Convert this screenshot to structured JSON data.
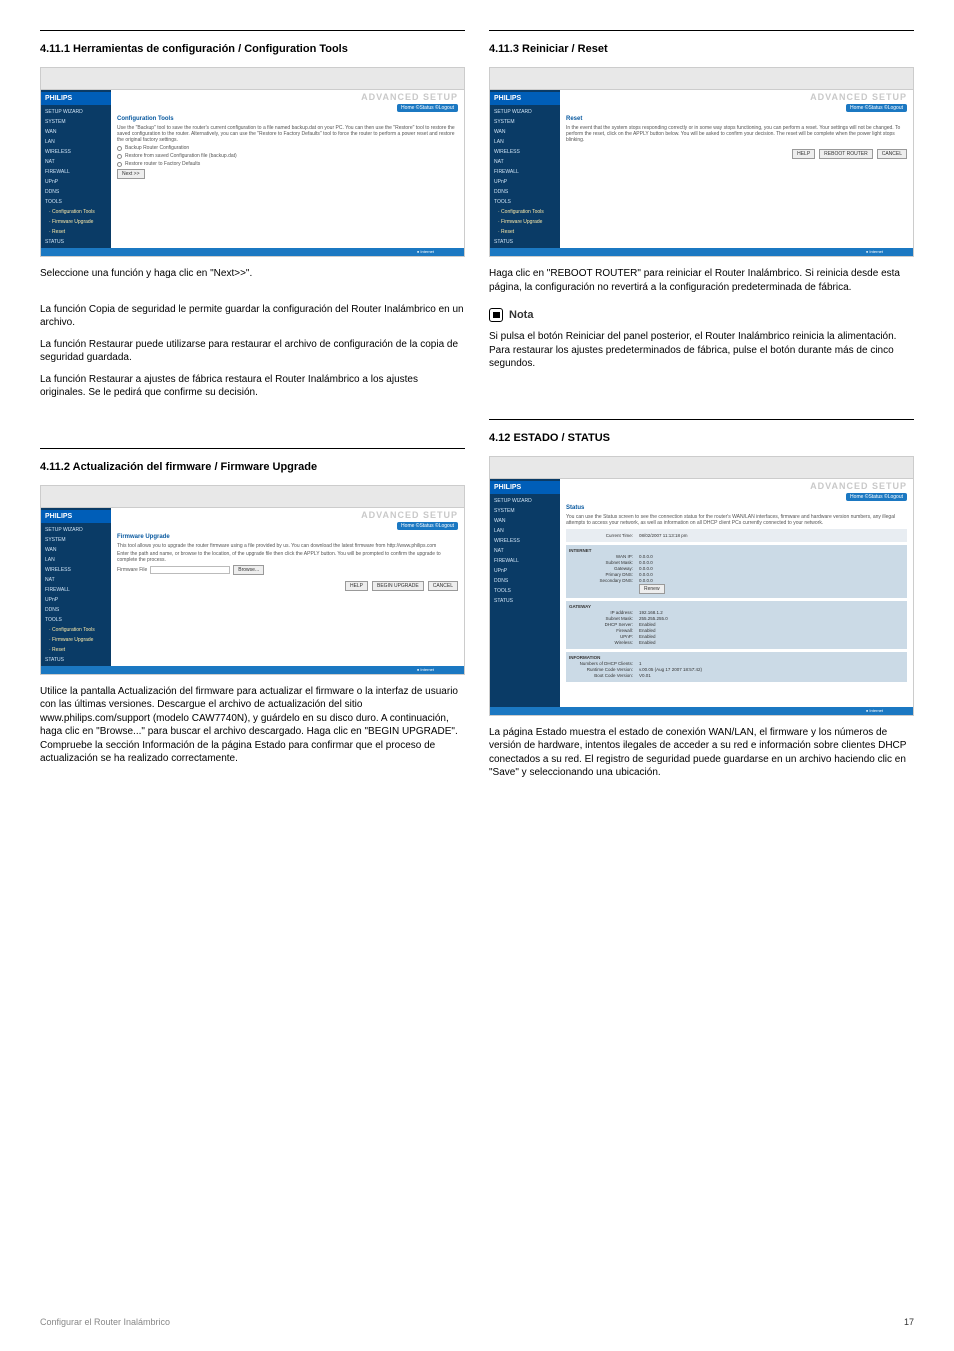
{
  "sections": {
    "s4111": {
      "title": "4.11.1 Herramientas de configuración / Configuration Tools",
      "caption": "Seleccione una función y haga clic en \"Next>>\".",
      "para1": "La función Copia de seguridad le permite guardar la configuración del Router Inalámbrico en un archivo.",
      "para2": "La función Restaurar puede utilizarse para restaurar el archivo de configuración de la copia de seguridad guardada.",
      "para3": "La función Restaurar a ajustes de fábrica restaura el Router Inalámbrico a los ajustes originales. Se le pedirá que confirme su decisión."
    },
    "s4112": {
      "title": "4.11.2 Actualización del firmware / Firmware Upgrade",
      "para1": "Utilice la pantalla Actualización del firmware para actualizar el firmware o la interfaz de usuario con las últimas versiones. Descargue el archivo de actualización del sitio www.philips.com/support (modelo CAW7740N), y guárdelo en su disco duro. A continuación, haga clic en \"Browse...\" para buscar el archivo descargado. Haga clic en \"BEGIN UPGRADE\". Compruebe la sección Información de la página Estado para confirmar que el proceso de actualización se ha realizado correctamente."
    },
    "s4113": {
      "title": "4.11.3 Reiniciar / Reset",
      "para1": "Haga clic en \"REBOOT ROUTER\" para reiniciar el Router Inalámbrico. Si reinicia desde esta página, la configuración no revertirá a la configuración predeterminada de fábrica."
    },
    "nota": {
      "label": "Nota",
      "text": "Si pulsa el botón Reiniciar del panel posterior, el Router Inalámbrico reinicia la alimentación. Para restaurar los ajustes predeterminados de fábrica, pulse el botón durante más de cinco segundos."
    },
    "s412": {
      "title": "4.12  ESTADO / STATUS",
      "para1": "La página Estado muestra el estado de conexión WAN/LAN, el firmware y los números de versión de hardware, intentos ilegales de acceder a su red e información sobre clientes DHCP conectados a su red. El registro de seguridad puede guardarse en un archivo haciendo clic en \"Save\" y seleccionando una ubicación."
    }
  },
  "shots": {
    "common": {
      "brand": "PHILIPS",
      "advanced": "ADVANCED SETUP",
      "pill": "Home  ©Status  ©Logout",
      "footerlabel": "● Internet"
    },
    "sidebar": {
      "items": [
        "SETUP WIZARD",
        "SYSTEM",
        "WAN",
        "LAN",
        "WIRELESS",
        "NAT",
        "FIREWALL",
        "UPnP",
        "DDNS",
        "TOOLS"
      ],
      "tools_sub": [
        " · Configuration Tools",
        " · Firmware Upgrade",
        " · Reset"
      ],
      "status_item": "STATUS"
    },
    "config_tools": {
      "title": "Configuration Tools",
      "desc": "Use the \"Backup\" tool to save the router's current configuration to a file named backup.dat on your PC. You can then use the \"Restore\" tool to restore the saved configuration to the router. Alternatively, you can use the \"Restore to Factory Defaults\" tool to force the router to perform a power reset and restore the original factory settings.",
      "opt1": "Backup Router Configuration",
      "opt2": "Restore from saved Configuration file (backup.dat)",
      "opt3": "Restore router to Factory Defaults",
      "next": "Next >>"
    },
    "firmware": {
      "title": "Firmware Upgrade",
      "desc1": "This tool allows you to upgrade the router firmware using a file provided by us. You can download the latest firmware from http://www.philips.com",
      "desc2": "Enter the path and name, or browse to the location, of the upgrade file then click the APPLY button. You will be prompted to confirm the upgrade to complete the process.",
      "label": "Firmware File",
      "browse": "Browse...",
      "help": "HELP",
      "begin": "BEGIN UPGRADE",
      "cancel": "CANCEL"
    },
    "reset": {
      "title": "Reset",
      "desc": "In the event that the system stops responding correctly or in some way stops functioning, you can perform a reset. Your settings will not be changed. To perform the reset, click on the APPLY button below. You will be asked to confirm your decision. The reset will be complete when the power light stops blinking.",
      "help": "HELP",
      "reboot": "REBOOT ROUTER",
      "cancel": "CANCEL"
    },
    "status": {
      "title": "Status",
      "desc": "You can use the Status screen to see the connection status for the router's WAN/LAN interfaces, firmware and hardware version numbers, any illegal attempts to access your network, as well as information on all DHCP client PCs currently connected to your network.",
      "current_time_label": "Current Time:",
      "current_time_value": "08/02/2007 11:13:18 pm",
      "internet": {
        "header": "INTERNET",
        "kv": [
          {
            "k": "WAN IP:",
            "v": "0.0.0.0"
          },
          {
            "k": "Subnet Mask:",
            "v": "0.0.0.0"
          },
          {
            "k": "Gateway:",
            "v": "0.0.0.0"
          },
          {
            "k": "Primary DNS:",
            "v": "0.0.0.0"
          },
          {
            "k": "Secondary DNS:",
            "v": "0.0.0.0"
          }
        ],
        "btn": "Renew"
      },
      "gateway": {
        "header": "GATEWAY",
        "kv": [
          {
            "k": "IP address:",
            "v": "192.168.1.2"
          },
          {
            "k": "Subnet Mask:",
            "v": "255.255.255.0"
          },
          {
            "k": "DHCP Server:",
            "v": "Enabled"
          },
          {
            "k": "Firewall:",
            "v": "Enabled"
          },
          {
            "k": "UPnP:",
            "v": "Enabled"
          },
          {
            "k": "Wireless:",
            "v": "Enabled"
          }
        ]
      },
      "info": {
        "header": "INFORMATION",
        "kv": [
          {
            "k": "Numbers of DHCP Clients:",
            "v": "1"
          },
          {
            "k": "Runtime Code Version:",
            "v": "v.00.05 (Aug 17 2007 18:57:42)"
          },
          {
            "k": "Boot Code Version:",
            "v": "V0.01"
          }
        ]
      }
    }
  },
  "footer": {
    "left": "Configurar el Router Inalámbrico",
    "right": "17"
  }
}
